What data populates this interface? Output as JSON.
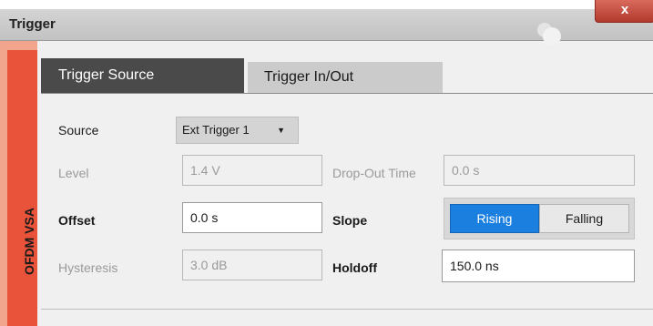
{
  "window": {
    "title": "Trigger",
    "close_label": "x"
  },
  "sidebar": {
    "label": "OFDM VSA"
  },
  "tabs": [
    {
      "label": "Trigger Source",
      "active": true
    },
    {
      "label": "Trigger In/Out",
      "active": false
    }
  ],
  "form": {
    "source": {
      "label": "Source",
      "value": "Ext Trigger 1"
    },
    "level": {
      "label": "Level",
      "value": "1.4 V",
      "enabled": false
    },
    "dropout": {
      "label": "Drop-Out Time",
      "value": "0.0 s",
      "enabled": false
    },
    "offset": {
      "label": "Offset",
      "value": "0.0 s"
    },
    "slope": {
      "label": "Slope",
      "options": [
        "Rising",
        "Falling"
      ],
      "selected": "Rising"
    },
    "hysteresis": {
      "label": "Hysteresis",
      "value": "3.0 dB",
      "enabled": false
    },
    "holdoff": {
      "label": "Holdoff",
      "value": "150.0 ns"
    }
  },
  "colors": {
    "accent": "#1b7fe0",
    "sidebar_tab": "#e8533a",
    "close_button": "#c8483a"
  },
  "icons": {
    "window_bubbles": "bubbles-icon",
    "close": "close-icon",
    "dropdown": "triangle-down-icon"
  }
}
